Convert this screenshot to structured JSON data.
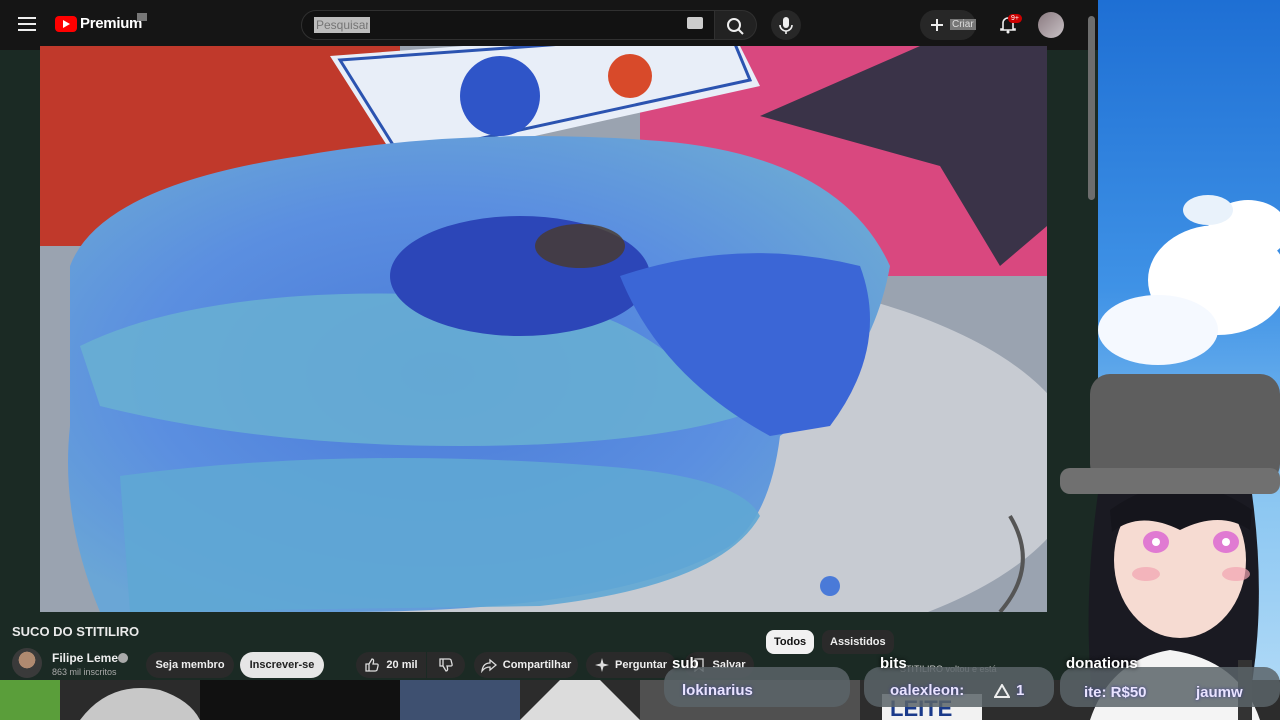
{
  "header": {
    "logo_text": "Premium",
    "search_placeholder": "Pesquisar",
    "create_label": "Criar",
    "notification_count": "9+"
  },
  "video": {
    "title": "SUCO DO STITILIRO"
  },
  "channel": {
    "name": "Filipe Leme",
    "subscribers": "863 mil inscritos",
    "join_label": "Seja membro",
    "subscribe_label": "Inscrever-se"
  },
  "actions": {
    "likes": "20 mil",
    "share": "Compartilhar",
    "ask": "Perguntar",
    "save": "Salvar"
  },
  "chips": {
    "all": "Todos",
    "watched": "Assistidos",
    "notice": "STITILIRO voltou e está"
  },
  "stream_overlay": {
    "label_sub": "sub",
    "label_bits": "bits",
    "label_donations": "donations",
    "user_sub": "lokinarius",
    "user_bits": "oalexleon:",
    "bits_amount": "1",
    "donation_text": "ite: R$50",
    "user_donation": "jaumw",
    "sign_text": "LEITE"
  },
  "colors": {
    "youtube_red": "#ff0000",
    "page_bg": "#1b2a24",
    "sky_blue": "#3f92e6"
  }
}
